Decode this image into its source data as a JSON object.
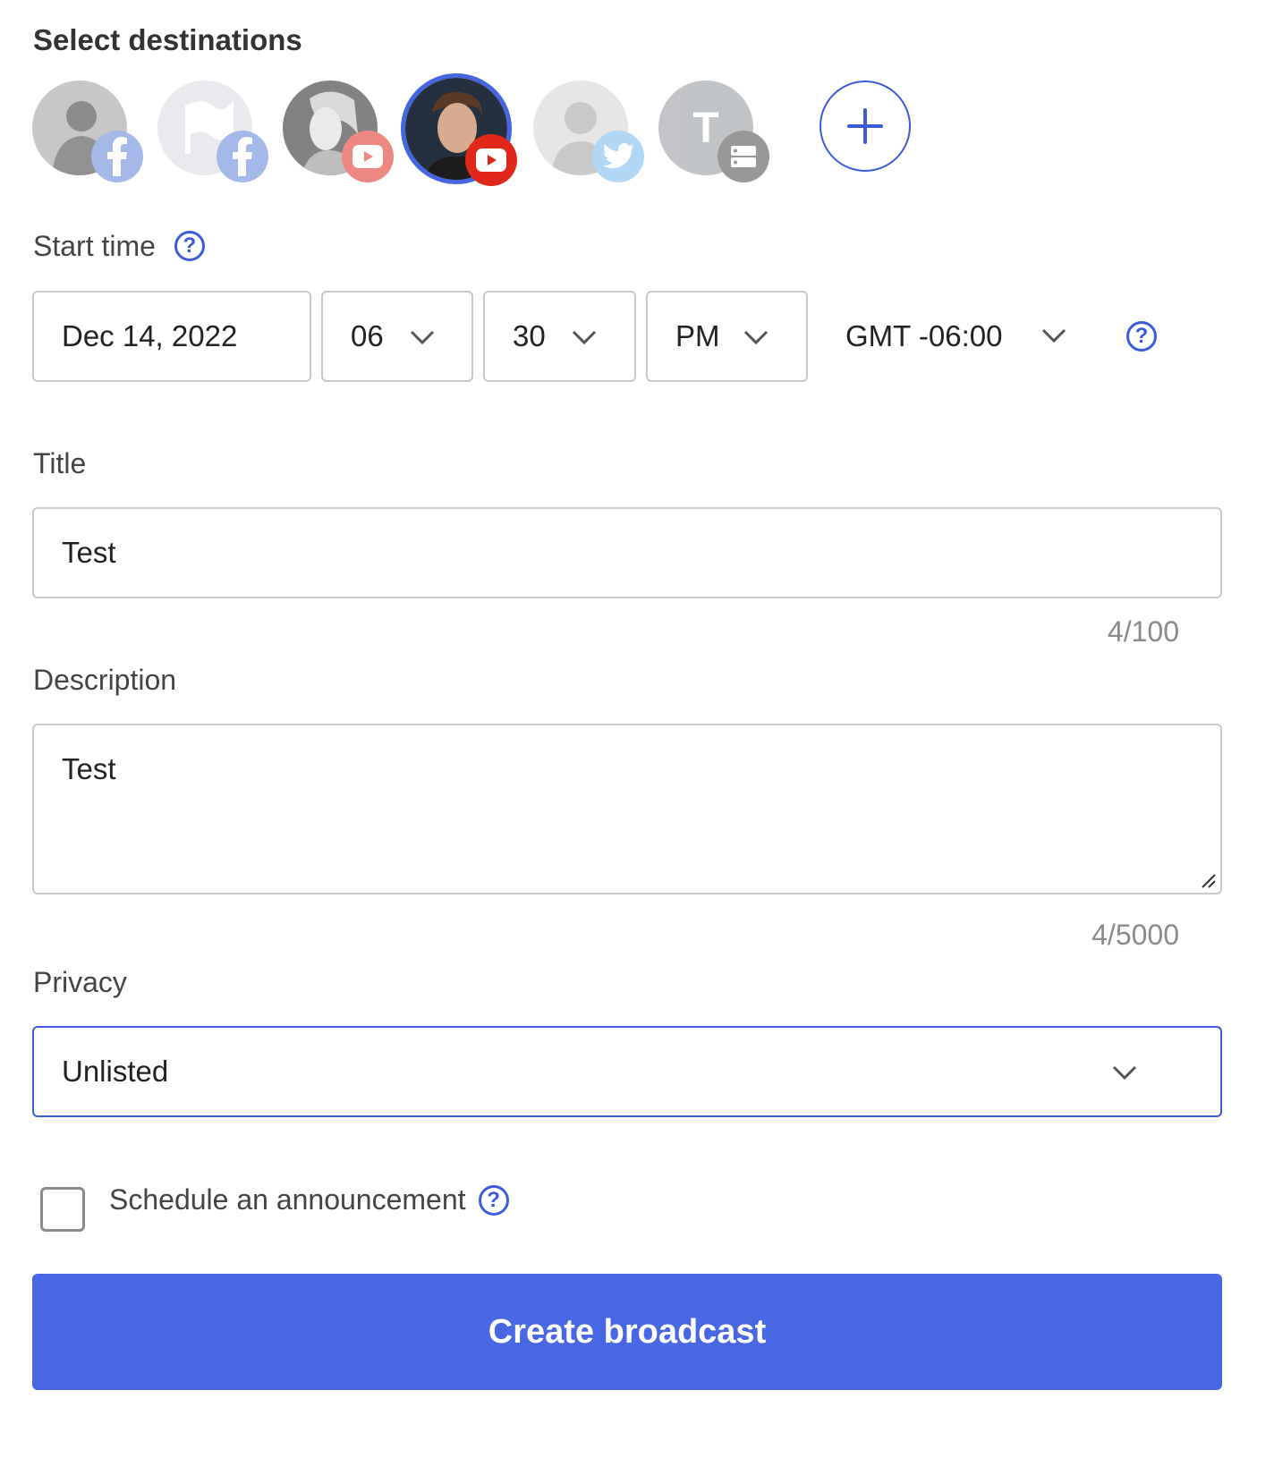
{
  "destinations": {
    "title": "Select destinations",
    "items": [
      {
        "platform": "facebook",
        "badge_icon": "facebook-icon",
        "selected": false
      },
      {
        "platform": "facebook",
        "badge_icon": "facebook-icon",
        "selected": false
      },
      {
        "platform": "youtube",
        "badge_icon": "youtube-icon",
        "selected": false
      },
      {
        "platform": "youtube",
        "badge_icon": "youtube-icon",
        "selected": true
      },
      {
        "platform": "twitter",
        "badge_icon": "twitter-icon",
        "selected": false
      },
      {
        "platform": "custom-server",
        "badge_icon": "server-icon",
        "selected": false,
        "initial": "T"
      }
    ],
    "add_icon": "plus-icon"
  },
  "start_time": {
    "label": "Start time",
    "date": "Dec 14, 2022",
    "hour": "06",
    "minute": "30",
    "ampm": "PM",
    "timezone": "GMT -06:00",
    "help_symbol": "?"
  },
  "title_field": {
    "label": "Title",
    "value": "Test",
    "counter": "4/100"
  },
  "description_field": {
    "label": "Description",
    "value": "Test",
    "counter": "4/5000"
  },
  "privacy": {
    "label": "Privacy",
    "value": "Unlisted"
  },
  "announcement": {
    "label": "Schedule an announcement",
    "checked": false
  },
  "submit": {
    "label": "Create broadcast"
  },
  "colors": {
    "accent": "#4767e3",
    "youtube": "#e02719",
    "facebook": "#5b7fd9",
    "twitter": "#72b8ef"
  }
}
